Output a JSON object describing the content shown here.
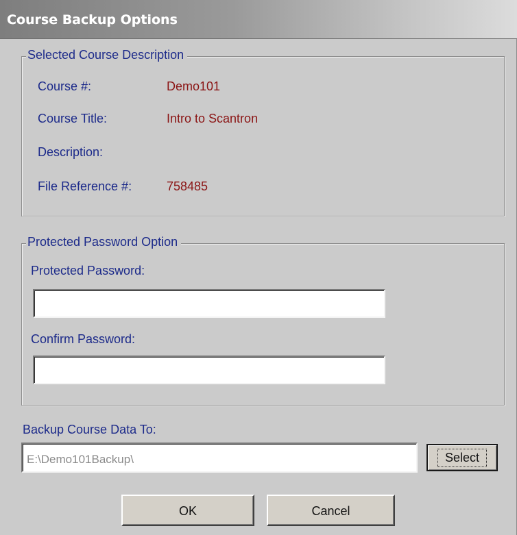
{
  "window": {
    "title": "Course Backup Options"
  },
  "course_group": {
    "legend": "Selected Course Description",
    "course_num_label": "Course #:",
    "course_num_value": "Demo101",
    "course_title_label": "Course Title:",
    "course_title_value": "Intro to Scantron",
    "description_label": "Description:",
    "description_value": "",
    "file_ref_label": "File Reference #:",
    "file_ref_value": "758485"
  },
  "password_group": {
    "legend": "Protected Password Option",
    "password_label": "Protected Password:",
    "password_value": "",
    "confirm_label": "Confirm Password:",
    "confirm_value": ""
  },
  "backup": {
    "label": "Backup Course Data To:",
    "path_value": "E:\\Demo101Backup\\",
    "select_label": "Select"
  },
  "buttons": {
    "ok_label": "OK",
    "cancel_label": "Cancel"
  }
}
